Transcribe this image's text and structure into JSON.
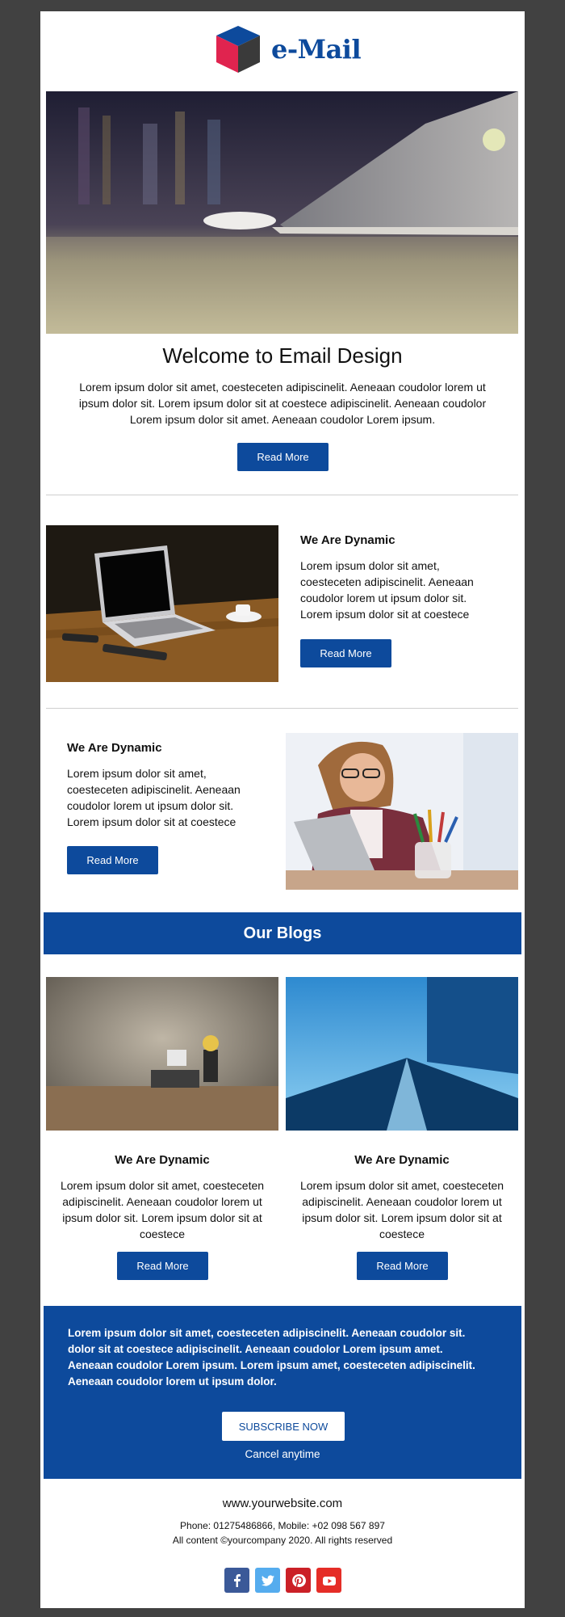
{
  "brand": {
    "name": "e-Mail",
    "color": "#0d4a9c"
  },
  "hero": {
    "title": "Welcome to Email Design",
    "text": "Lorem ipsum dolor sit amet, coesteceten adipiscinelit. Aeneaan coudolor lorem ut ipsum dolor sit. Lorem ipsum dolor sit at coestece adipiscinelit. Aeneaan coudolor Lorem ipsum dolor sit amet. Aeneaan coudolor Lorem ipsum.",
    "button": "Read More"
  },
  "feature1": {
    "title": "We Are Dynamic",
    "text": "Lorem ipsum dolor sit amet, coesteceten adipiscinelit. Aeneaan coudolor lorem ut ipsum dolor sit. Lorem ipsum dolor sit at coestece",
    "button": "Read More"
  },
  "feature2": {
    "title": "We Are Dynamic",
    "text": "Lorem ipsum dolor sit amet, coesteceten adipiscinelit. Aeneaan coudolor lorem ut ipsum dolor sit. Lorem ipsum dolor sit at coestece",
    "button": "Read More"
  },
  "blogs": {
    "heading": "Our Blogs",
    "items": [
      {
        "title": "We Are Dynamic",
        "text": "Lorem ipsum dolor sit amet, coesteceten adipiscinelit. Aeneaan coudolor lorem ut ipsum dolor sit. Lorem ipsum dolor sit at coestece",
        "button": "Read More"
      },
      {
        "title": "We Are Dynamic",
        "text": "Lorem ipsum dolor sit amet, coesteceten adipiscinelit. Aeneaan coudolor lorem ut ipsum dolor sit. Lorem ipsum dolor sit at coestece",
        "button": "Read More"
      }
    ]
  },
  "subscribe": {
    "text": "Lorem ipsum dolor sit amet, coesteceten adipiscinelit. Aeneaan coudolor sit. dolor sit at coestece adipiscinelit. Aeneaan coudolor Lorem ipsum amet. Aeneaan coudolor Lorem ipsum. Lorem ipsum amet, coesteceten adipiscinelit. Aeneaan coudolor lorem ut ipsum dolor.",
    "button": "SUBSCRIBE NOW",
    "cancel": "Cancel anytime"
  },
  "footer": {
    "website": "www.yourwebsite.com",
    "contact": "Phone: 01275486866, Mobile: +02 098 567 897",
    "copyright": "All content ©yourcompany 2020. All rights reserved",
    "socials": [
      {
        "icon": "facebook-icon",
        "color": "#3b5998"
      },
      {
        "icon": "twitter-icon",
        "color": "#55acee"
      },
      {
        "icon": "pinterest-icon",
        "color": "#cb2027"
      },
      {
        "icon": "youtube-icon",
        "color": "#e52d27"
      }
    ]
  }
}
